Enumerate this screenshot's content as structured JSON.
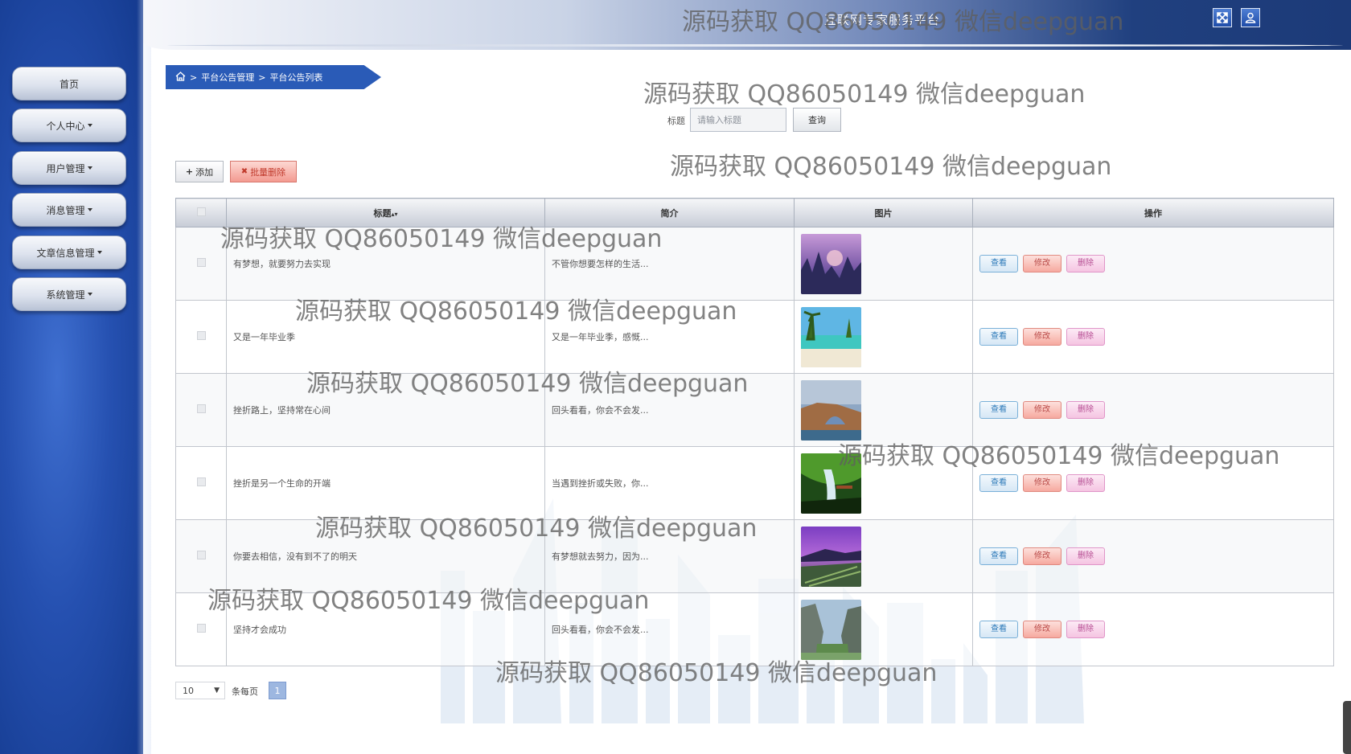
{
  "header": {
    "site_title": "互联网专家服务平台"
  },
  "sidebar": {
    "items": [
      {
        "label": "首页",
        "dropdown": false
      },
      {
        "label": "个人中心",
        "dropdown": true
      },
      {
        "label": "用户管理",
        "dropdown": true
      },
      {
        "label": "消息管理",
        "dropdown": true
      },
      {
        "label": "文章信息管理",
        "dropdown": true
      },
      {
        "label": "系统管理",
        "dropdown": true
      }
    ]
  },
  "breadcrumb": {
    "items": [
      "平台公告管理",
      "平台公告列表"
    ]
  },
  "search": {
    "label": "标题",
    "placeholder": "请输入标题",
    "button_label": "查询"
  },
  "toolbar": {
    "add_label": "添加",
    "batch_delete_label": "批量删除"
  },
  "table": {
    "headers": [
      "",
      "标题",
      "简介",
      "图片",
      "操作"
    ],
    "actions": {
      "view": "查看",
      "edit": "修改",
      "delete": "删除"
    },
    "rows": [
      {
        "title": "有梦想，就要努力去实现",
        "intro": "不管你想要怎样的生活...",
        "image": "landscape-purple-forest"
      },
      {
        "title": "又是一年毕业季",
        "intro": "又是一年毕业季，感慨...",
        "image": "landscape-tropical-beach"
      },
      {
        "title": "挫折路上，坚持常在心间",
        "intro": "回头看看，你会不会发...",
        "image": "landscape-rock-arch"
      },
      {
        "title": "挫折是另一个生命的开端",
        "intro": "当遇到挫折或失败，你...",
        "image": "landscape-green-waterfall"
      },
      {
        "title": "你要去相信，没有到不了的明天",
        "intro": "有梦想就去努力，因为...",
        "image": "landscape-purple-shore"
      },
      {
        "title": "坚持才会成功",
        "intro": "回头看看，你会不会发...",
        "image": "landscape-canyon-river"
      }
    ]
  },
  "pager": {
    "page_size": "10",
    "per_page_label": "条每页",
    "current_page": "1"
  },
  "watermark": {
    "text": "源码获取 QQ86050149 微信deepguan"
  },
  "colors": {
    "sidebar": "#2550b0",
    "breadcrumb": "#2a5bb7",
    "view_button": "#2a78b8",
    "edit_button": "#b94a48",
    "delete_button": "#b64c92"
  }
}
